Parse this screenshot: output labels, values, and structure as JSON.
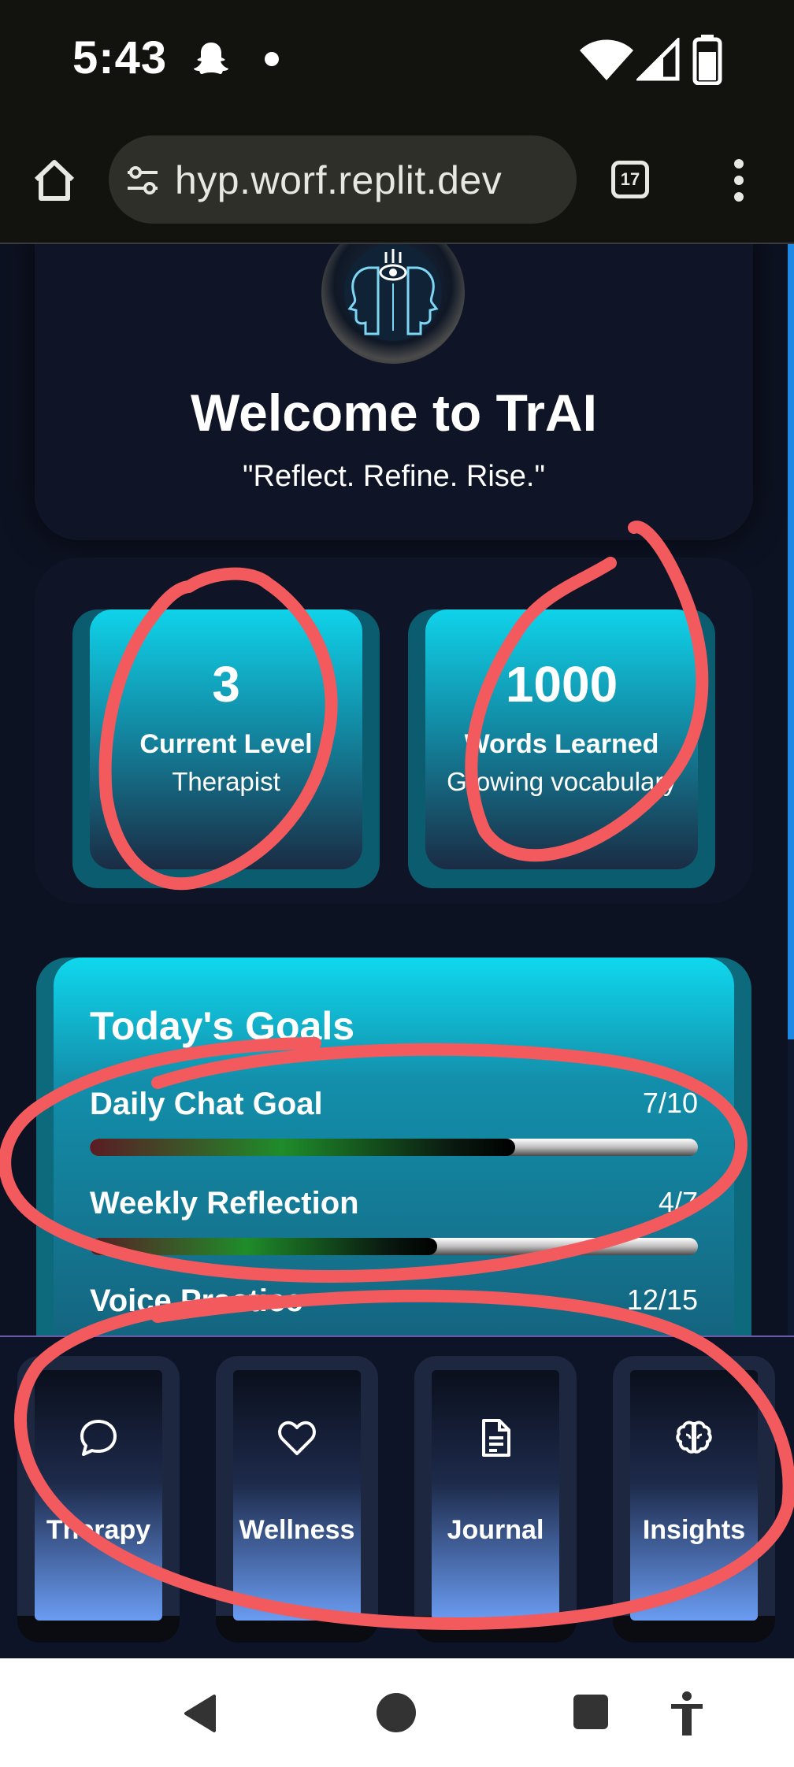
{
  "status_bar": {
    "time": "5:43",
    "icons": [
      "snapchat-icon",
      "notification-dot-icon",
      "wifi-icon",
      "signal-icon",
      "battery-icon"
    ]
  },
  "browser": {
    "url": "hyp.worf.replit.dev",
    "tab_count": "17",
    "icons": [
      "home-icon",
      "site-settings-icon",
      "tab-switcher-icon",
      "more-vert-icon"
    ]
  },
  "hero": {
    "title": "Welcome to TrAI",
    "subtitle": "\"Reflect. Refine. Rise.\""
  },
  "stats": [
    {
      "value": "3",
      "label": "Current Level",
      "description": "Therapist"
    },
    {
      "value": "1000",
      "label": "Words Learned",
      "description": "Growing vocabulary"
    }
  ],
  "goals": {
    "title": "Today's Goals",
    "items": [
      {
        "name": "Daily Chat Goal",
        "count": "7/10",
        "progress": 0.7
      },
      {
        "name": "Weekly Reflection",
        "count": "4/7",
        "progress": 0.5714
      },
      {
        "name": "Voice Practice",
        "count": "12/15",
        "progress": 0.8
      }
    ]
  },
  "nav": {
    "items": [
      {
        "label": "Therapy",
        "icon": "chat-bubble-icon"
      },
      {
        "label": "Wellness",
        "icon": "heart-icon"
      },
      {
        "label": "Journal",
        "icon": "document-icon"
      },
      {
        "label": "Insights",
        "icon": "brain-icon"
      }
    ]
  },
  "system_nav": {
    "icons": [
      "back-icon",
      "home-circle-icon",
      "recents-icon",
      "accessibility-icon"
    ]
  },
  "colors": {
    "background": "#0d1222",
    "tile_accent": "#0fd3ea",
    "nav_gradient_bottom": "#6a9cf2",
    "annotation": "#f25a5e"
  }
}
